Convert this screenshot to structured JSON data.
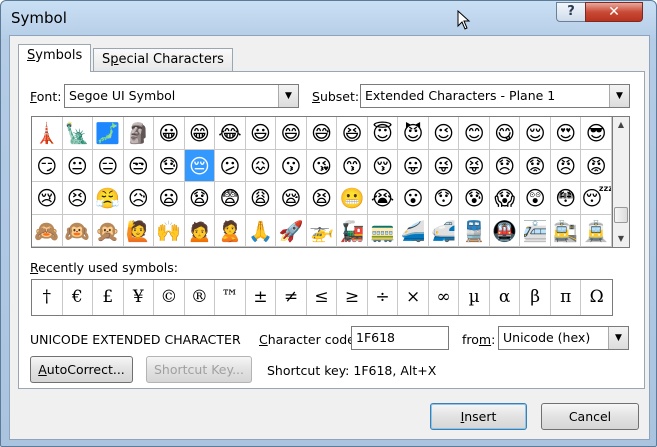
{
  "window": {
    "title": "Symbol",
    "help_label": "?",
    "close_label": "✕"
  },
  "tabs": [
    {
      "label_pre": "",
      "label_key": "S",
      "label_post": "ymbols"
    },
    {
      "label_pre": "S",
      "label_key": "p",
      "label_post": "ecial Characters"
    }
  ],
  "font": {
    "label_key": "F",
    "label_post": "ont:",
    "value": "Segoe UI Symbol"
  },
  "subset": {
    "label_key": "S",
    "label_post": "ubset:",
    "value": "Extended Characters - Plane 1"
  },
  "symbols": [
    "🗼",
    "🗽",
    "🗾",
    "🗿",
    "😀",
    "😁",
    "😂",
    "😃",
    "😄",
    "😅",
    "😆",
    "😇",
    "😈",
    "😉",
    "😊",
    "😋",
    "😌",
    "😍",
    "😎",
    "😏",
    "😐",
    "😑",
    "😒",
    "😓",
    "😔",
    "😕",
    "😖",
    "😗",
    "😘",
    "😙",
    "😚",
    "😛",
    "😜",
    "😝",
    "😞",
    "😟",
    "😠",
    "😡",
    "😢",
    "😣",
    "😤",
    "😥",
    "😦",
    "😧",
    "😨",
    "😩",
    "😪",
    "😫",
    "😬",
    "😭",
    "😮",
    "😯",
    "😰",
    "😱",
    "😲",
    "😳",
    "😴",
    "🙈",
    "🙉",
    "🙊",
    "🙋",
    "🙌",
    "🙍",
    "🙎",
    "🙏",
    "🚀",
    "🚁",
    "🚂",
    "🚃",
    "🚄",
    "🚅",
    "🚆",
    "🚇",
    "🚈",
    "🚉",
    "🚊"
  ],
  "selected_index": 24,
  "recent": {
    "label_key": "R",
    "label_post": "ecently used symbols:",
    "items": [
      "†",
      "€",
      "£",
      "¥",
      "©",
      "®",
      "™",
      "±",
      "≠",
      "≤",
      "≥",
      "÷",
      "×",
      "∞",
      "µ",
      "α",
      "β",
      "π",
      "Ω"
    ]
  },
  "char_name": "UNICODE EXTENDED CHARACTER",
  "char_code": {
    "label_key": "C",
    "label_pre": "",
    "label_post": "haracter code:",
    "value": "1F618"
  },
  "from": {
    "label_pre": "fro",
    "label_key": "m",
    "label_post": ":",
    "value": "Unicode (hex)"
  },
  "buttons": {
    "autocorrect": {
      "key": "A",
      "post": "utoCorrect..."
    },
    "shortcut_key": "Shortcut Key...",
    "insert": {
      "key": "I",
      "post": "nsert"
    },
    "cancel": "Cancel"
  },
  "shortcut_text": "Shortcut key: 1F618, Alt+X"
}
